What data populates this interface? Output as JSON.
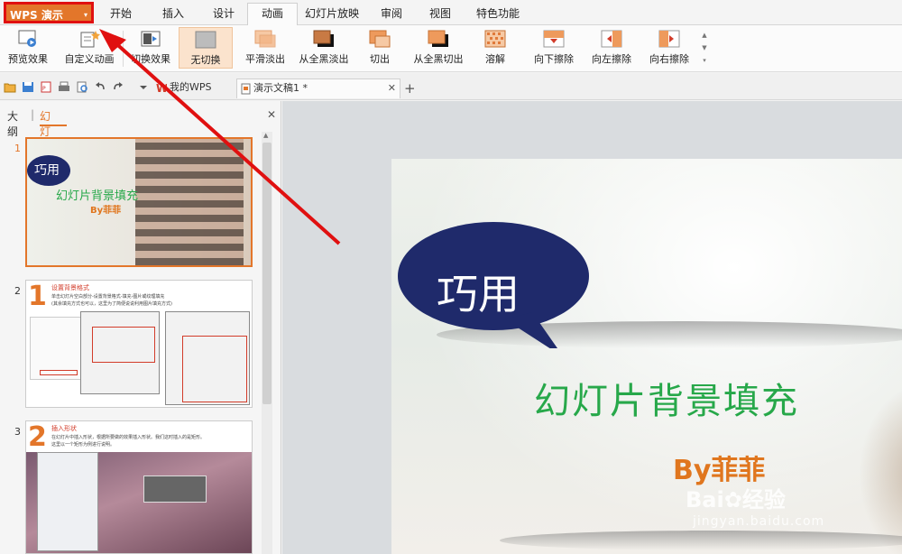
{
  "app_button": {
    "label": "WPS 演示",
    "caret": "▾"
  },
  "menu_tabs": [
    {
      "label": "开始"
    },
    {
      "label": "插入"
    },
    {
      "label": "设计"
    },
    {
      "label": "动画"
    },
    {
      "label": "幻灯片放映"
    },
    {
      "label": "审阅"
    },
    {
      "label": "视图"
    },
    {
      "label": "特色功能"
    }
  ],
  "ribbon": {
    "preview": "预览效果",
    "custom_anim": "自定义动画",
    "transition": "切换效果",
    "effects": [
      {
        "label": "无切换"
      },
      {
        "label": "平滑淡出"
      },
      {
        "label": "从全黑淡出"
      },
      {
        "label": "切出"
      },
      {
        "label": "从全黑切出"
      },
      {
        "label": "溶解"
      },
      {
        "label": "向下擦除"
      },
      {
        "label": "向左擦除"
      },
      {
        "label": "向右擦除"
      }
    ]
  },
  "doc_tabs": [
    {
      "label": "我的WPS"
    },
    {
      "label": "演示文稿1 *"
    }
  ],
  "new_tab": "+",
  "panel": {
    "tab_outline": "大纲",
    "tab_slides": "幻灯片",
    "close": "✕",
    "slides": [
      {
        "num": "1",
        "bubble": "巧用",
        "title": "幻灯片背景填充",
        "by": "By菲菲"
      },
      {
        "num": "2",
        "heading": "设置背景格式",
        "body1": "单击幻灯片空白部分-设置背景格式-填充-图片或纹理填充",
        "body2": "(其余填充方式也可以，这里为了简便说说利用图片填充方式)"
      },
      {
        "num": "3",
        "heading": "插入形状",
        "body1": "在幻灯片中插入形状，根据所要做的效果插入形状。我们这时插入的是矩形。",
        "body2": "这里以一个矩形为例进行说明。"
      }
    ]
  },
  "slide": {
    "bubble_text": "巧用",
    "title": "幻灯片背景填充",
    "byline": "By菲菲"
  },
  "watermark": {
    "brand": "Bai",
    "paw": "✿",
    "brand2": "经验",
    "url": "jingyan.baidu.com"
  },
  "colors": {
    "accent": "#e3762a",
    "highlight": "#e01010",
    "bubble": "#1f2a6b",
    "title_green": "#27a84a"
  }
}
